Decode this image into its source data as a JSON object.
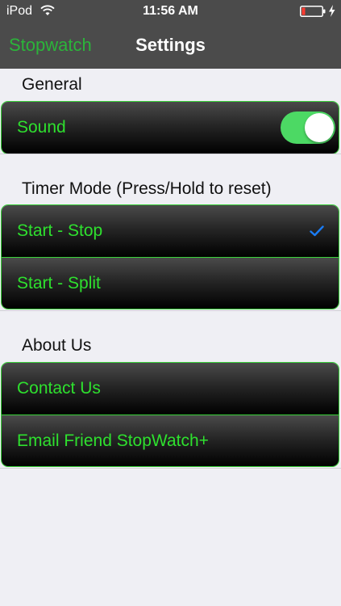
{
  "status_bar": {
    "carrier": "iPod",
    "time": "11:56 AM",
    "wifi_icon": "wifi-icon",
    "battery_icon": "battery-low-icon",
    "charging_icon": "charging-bolt-icon"
  },
  "nav": {
    "back_label": "Stopwatch",
    "title": "Settings"
  },
  "sections": {
    "general": {
      "header": "General",
      "sound_label": "Sound",
      "sound_enabled": true
    },
    "timer_mode": {
      "header": "Timer Mode (Press/Hold to reset)",
      "option_start_stop": "Start - Stop",
      "option_start_split": "Start - Split",
      "selected": "Start - Stop",
      "check_icon": "checkmark-icon"
    },
    "about": {
      "header": "About Us",
      "contact_label": "Contact Us",
      "email_friend_label": "Email Friend StopWatch+"
    }
  },
  "colors": {
    "accent_green": "#2ee02e",
    "nav_back_green": "#2bb43a",
    "toggle_on": "#4cd964",
    "check_blue": "#1a7cf5",
    "header_bg": "#4b4b4b",
    "page_bg": "#efeff4"
  }
}
